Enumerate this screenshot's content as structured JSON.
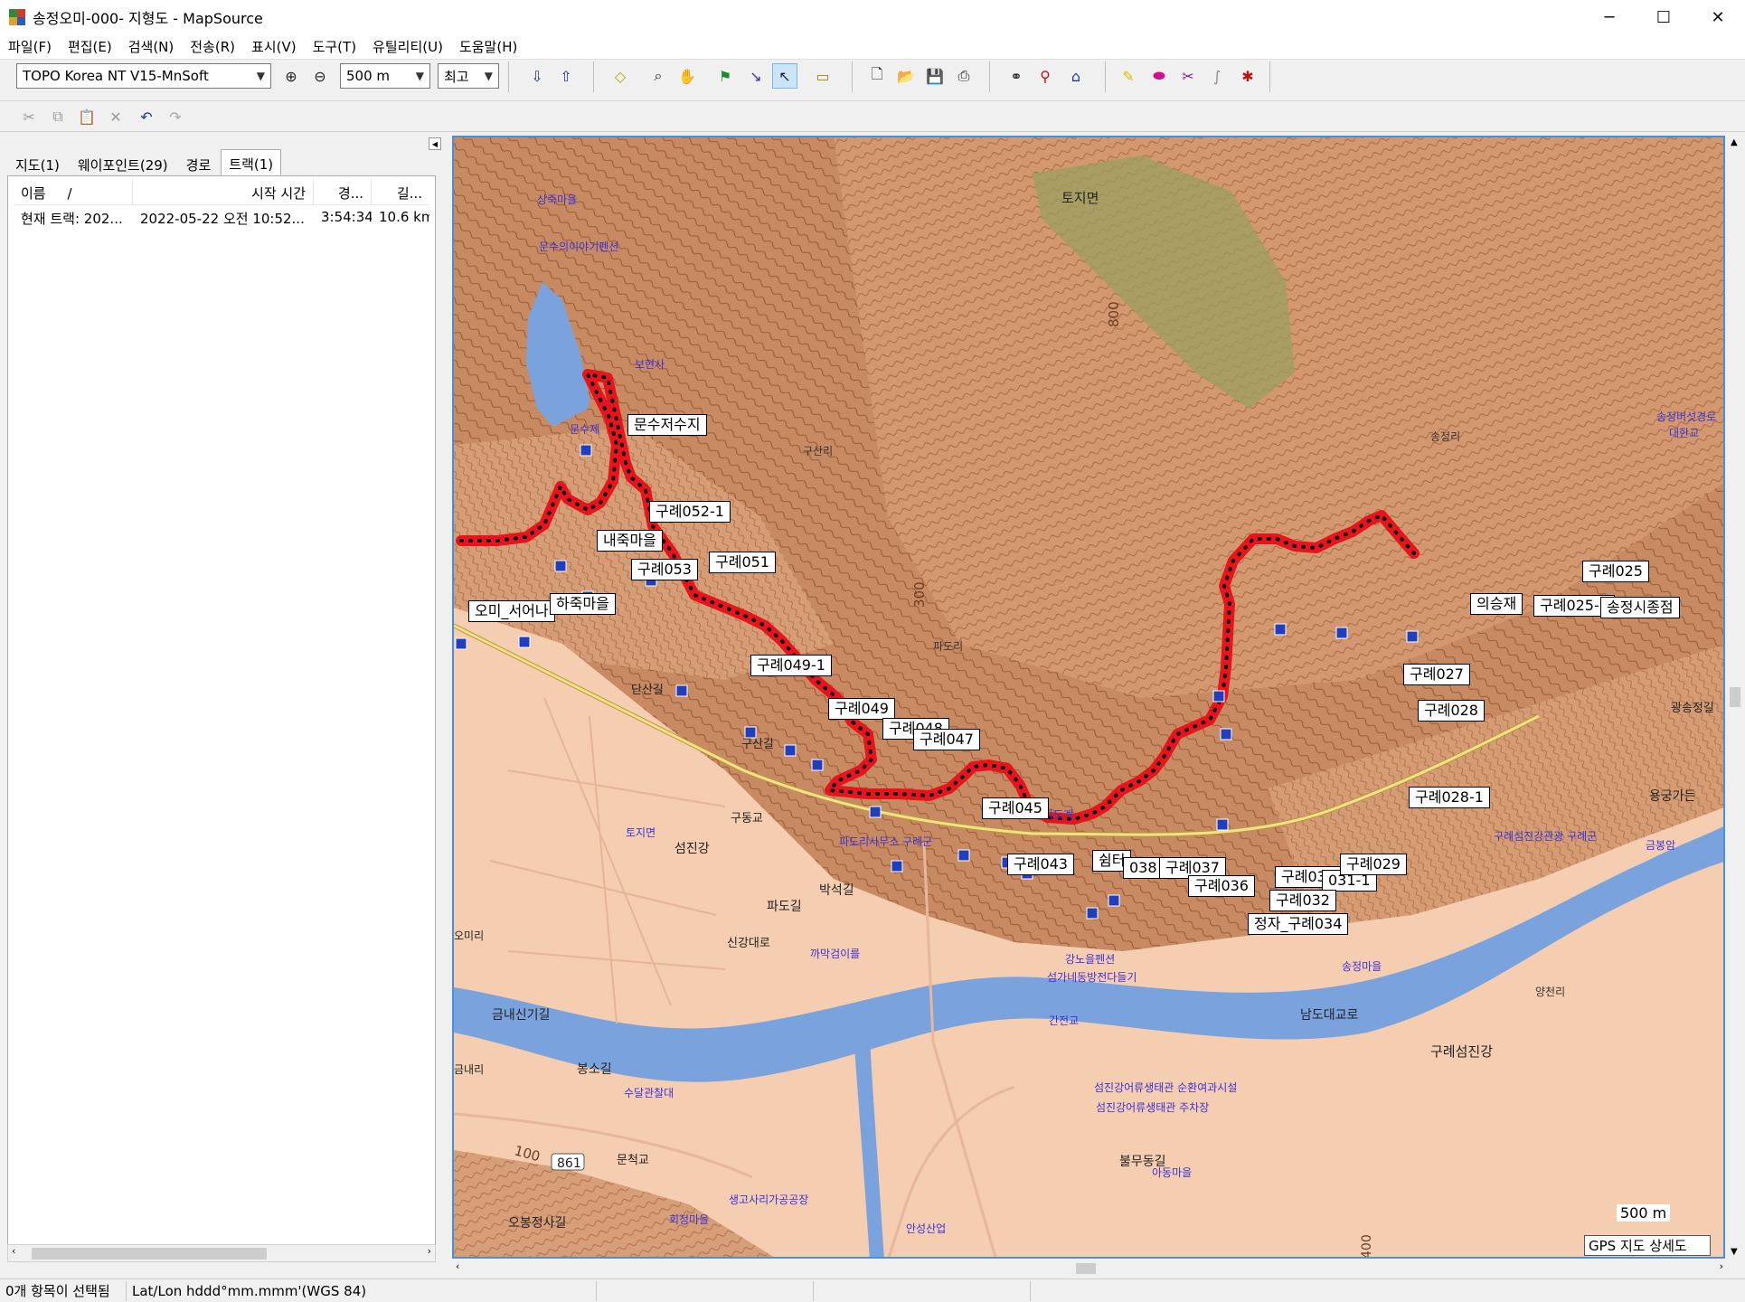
{
  "window": {
    "title": "송정오미-000- 지형도 - MapSource",
    "controls": [
      "─",
      "☐",
      "✕"
    ]
  },
  "menu": [
    "파일(F)",
    "편집(E)",
    "검색(N)",
    "전송(R)",
    "표시(V)",
    "도구(T)",
    "유틸리티(U)",
    "도움말(H)"
  ],
  "toolbar": {
    "map_product": "TOPO Korea NT V15-MnSoft",
    "zoom_scale": "500 m",
    "detail_level": "최고"
  },
  "left_panel": {
    "tabs": [
      "지도(1)",
      "웨이포인트(29)",
      "경로",
      "트랙(1)"
    ],
    "active_tab": "트랙(1)",
    "columns": [
      "이름",
      "/",
      "시작 시간",
      "경...",
      "길..."
    ],
    "rows": [
      {
        "name": "현재 트랙: 202...",
        "start": "2022-05-22 오전 10:52...",
        "duration": "3:54:34",
        "length": "10.6 km"
      }
    ]
  },
  "map": {
    "waypoints": [
      "문수저수지",
      "구례052-1",
      "내죽마을",
      "구례053",
      "구례051",
      "오미_서어나",
      "하죽마을",
      "구례049-1",
      "구례049",
      "구례048",
      "구례047",
      "구례045",
      "구례043",
      "쉼터",
      "038",
      "구례037",
      "구례036",
      "구례031-2",
      "031-1",
      "구례029",
      "구례032",
      "정자_구례034",
      "구례028-1",
      "구례028",
      "구례027",
      "의승재",
      "구례025-1",
      "구례025",
      "송정시종점"
    ],
    "places": [
      "상죽마을",
      "문수의이야기펜션",
      "보현사",
      "문수제",
      "구산리",
      "송정리",
      "파도리",
      "토지면",
      "송정버섯경로",
      "대한교",
      "용궁가든",
      "금봉암",
      "구례섬진강관광 구례군",
      "구례섬진강",
      "파도리사무소 구례군",
      "파도계",
      "송정마을",
      "까막검이를",
      "강노을펜션",
      "섬가네동방전다들기",
      "간전교",
      "남도대교로",
      "양천리",
      "섬진강어류생태관 순환여과시설",
      "섬진강어류생태관 주차장",
      "불무동길",
      "아동마을",
      "생고사리가공공장",
      "회정마을",
      "안성산업",
      "문척교",
      "섬진강",
      "토지면",
      "오미리",
      "오봉정사길",
      "봉소길",
      "수달관찰대",
      "금내신기길",
      "파도길",
      "박석길",
      "신강대로",
      "단산길",
      "구산길",
      "구동교",
      "광송정길",
      "금내리"
    ],
    "road_labels": [
      "861",
      "100",
      "300",
      "800",
      "400"
    ],
    "scale_text": "500 m",
    "detail_text": "GPS 지도 상세도"
  },
  "status": {
    "selection": "0개 항목이 선택됨",
    "coord_format": "Lat/Lon hddd°mm.mmm'(WGS 84)"
  },
  "colors": {
    "track": "#e8141b",
    "water": "#7aa2dc",
    "terrain": "#c9875e",
    "lowland": "#f6d1b5"
  }
}
